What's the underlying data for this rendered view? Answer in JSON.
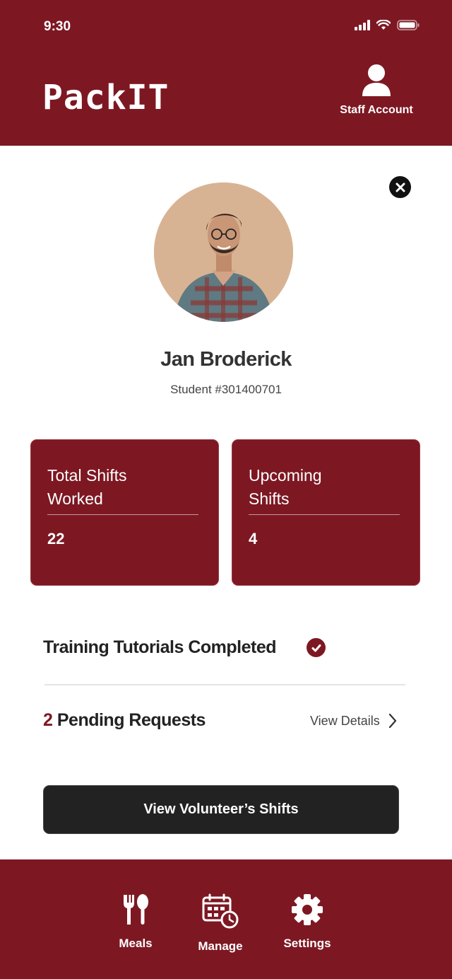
{
  "status_bar": {
    "time": "9:30"
  },
  "header": {
    "logo": "PackIT",
    "account_label": "Staff Account"
  },
  "profile": {
    "name": "Jan Broderick",
    "student_id": "Student #301400701"
  },
  "stats": [
    {
      "title_line1": "Total Shifts",
      "title_line2": "Worked",
      "value": "22"
    },
    {
      "title_line1": "Upcoming",
      "title_line2": "Shifts",
      "value": "4"
    }
  ],
  "training": {
    "label": "Training Tutorials Completed",
    "completed": true
  },
  "pending": {
    "count": "2",
    "label": "Pending Requests",
    "link_label": "View Details"
  },
  "main_button": {
    "label": "View Volunteer’s Shifts"
  },
  "nav": [
    {
      "label": "Meals",
      "icon": "fork-spoon-icon"
    },
    {
      "label": "Manage",
      "icon": "calendar-clock-icon"
    },
    {
      "label": "Settings",
      "icon": "gear-icon"
    }
  ],
  "colors": {
    "brand": "#7d1823",
    "dark": "#222222",
    "white": "#ffffff"
  }
}
